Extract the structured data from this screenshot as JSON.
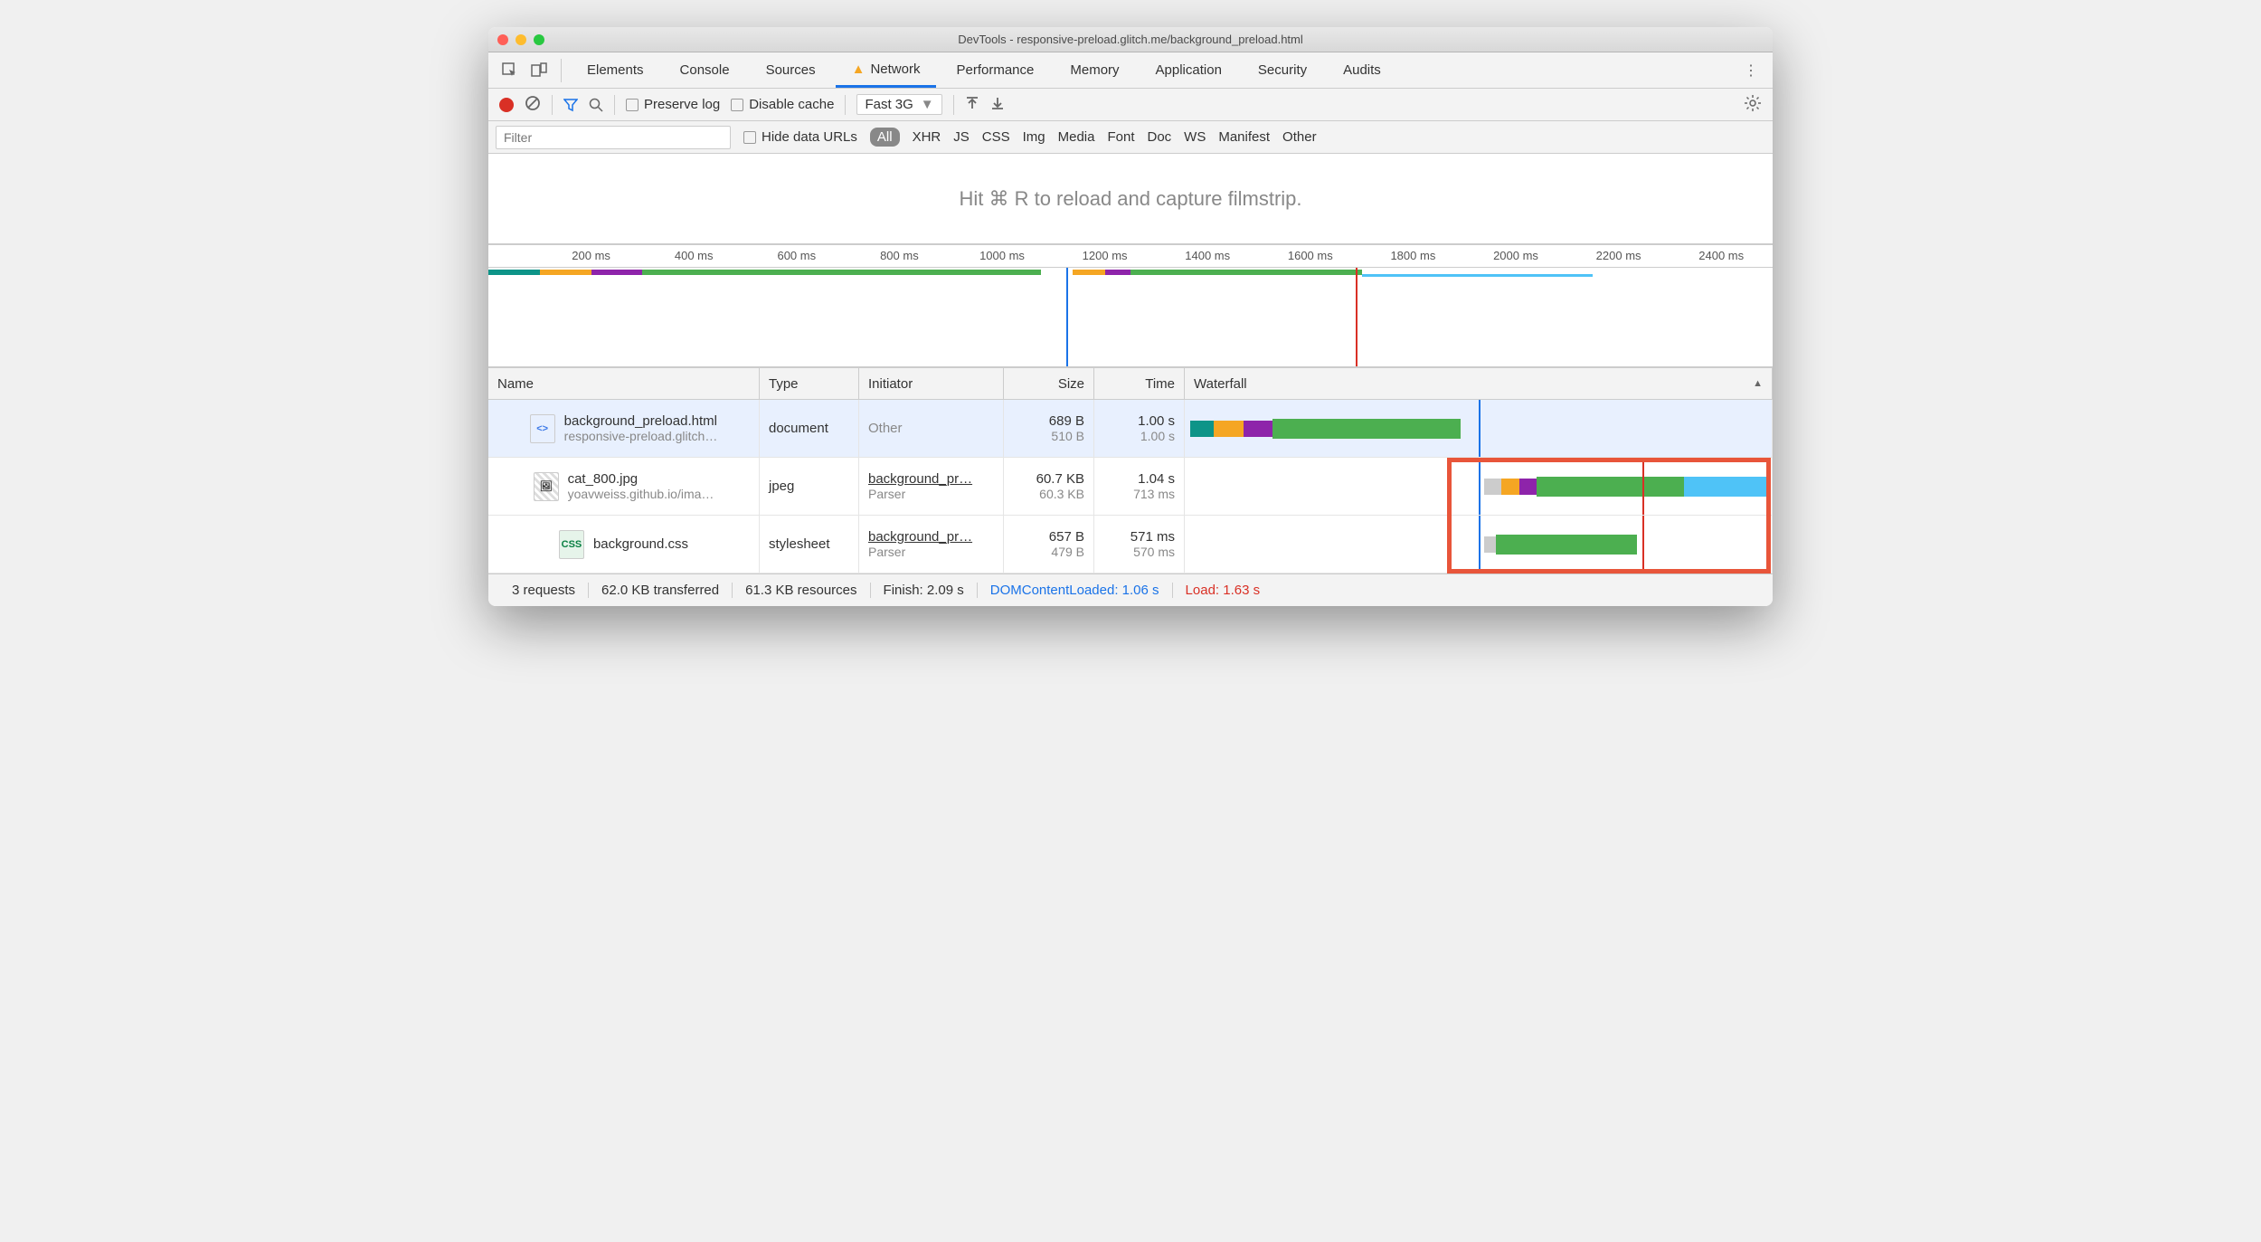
{
  "window": {
    "title": "DevTools - responsive-preload.glitch.me/background_preload.html"
  },
  "main_tabs": {
    "elements": "Elements",
    "console": "Console",
    "sources": "Sources",
    "network": "Network",
    "performance": "Performance",
    "memory": "Memory",
    "application": "Application",
    "security": "Security",
    "audits": "Audits"
  },
  "toolbar": {
    "preserve_log": "Preserve log",
    "disable_cache": "Disable cache",
    "throttle": "Fast 3G"
  },
  "filter": {
    "placeholder": "Filter",
    "hide_data_urls": "Hide data URLs",
    "types": {
      "all": "All",
      "xhr": "XHR",
      "js": "JS",
      "css": "CSS",
      "img": "Img",
      "media": "Media",
      "font": "Font",
      "doc": "Doc",
      "ws": "WS",
      "manifest": "Manifest",
      "other": "Other"
    }
  },
  "filmstrip_msg": "Hit ⌘ R to reload and capture filmstrip.",
  "ruler": [
    "200 ms",
    "400 ms",
    "600 ms",
    "800 ms",
    "1000 ms",
    "1200 ms",
    "1400 ms",
    "1600 ms",
    "1800 ms",
    "2000 ms",
    "2200 ms",
    "2400 ms"
  ],
  "columns": {
    "name": "Name",
    "type": "Type",
    "initiator": "Initiator",
    "size": "Size",
    "time": "Time",
    "waterfall": "Waterfall"
  },
  "requests": [
    {
      "name": "background_preload.html",
      "sub": "responsive-preload.glitch…",
      "type": "document",
      "initiator": "Other",
      "initiator_sub": "",
      "size": "689 B",
      "size_sub": "510 B",
      "time": "1.00 s",
      "time_sub": "1.00 s",
      "icon": "html"
    },
    {
      "name": "cat_800.jpg",
      "sub": "yoavweiss.github.io/ima…",
      "type": "jpeg",
      "initiator": "background_pr…",
      "initiator_sub": "Parser",
      "size": "60.7 KB",
      "size_sub": "60.3 KB",
      "time": "1.04 s",
      "time_sub": "713 ms",
      "icon": "img"
    },
    {
      "name": "background.css",
      "sub": "",
      "type": "stylesheet",
      "initiator": "background_pr…",
      "initiator_sub": "Parser",
      "size": "657 B",
      "size_sub": "479 B",
      "time": "571 ms",
      "time_sub": "570 ms",
      "icon": "css"
    }
  ],
  "status": {
    "requests": "3 requests",
    "transferred": "62.0 KB transferred",
    "resources": "61.3 KB resources",
    "finish": "Finish: 2.09 s",
    "dcl": "DOMContentLoaded: 1.06 s",
    "load": "Load: 1.63 s"
  }
}
